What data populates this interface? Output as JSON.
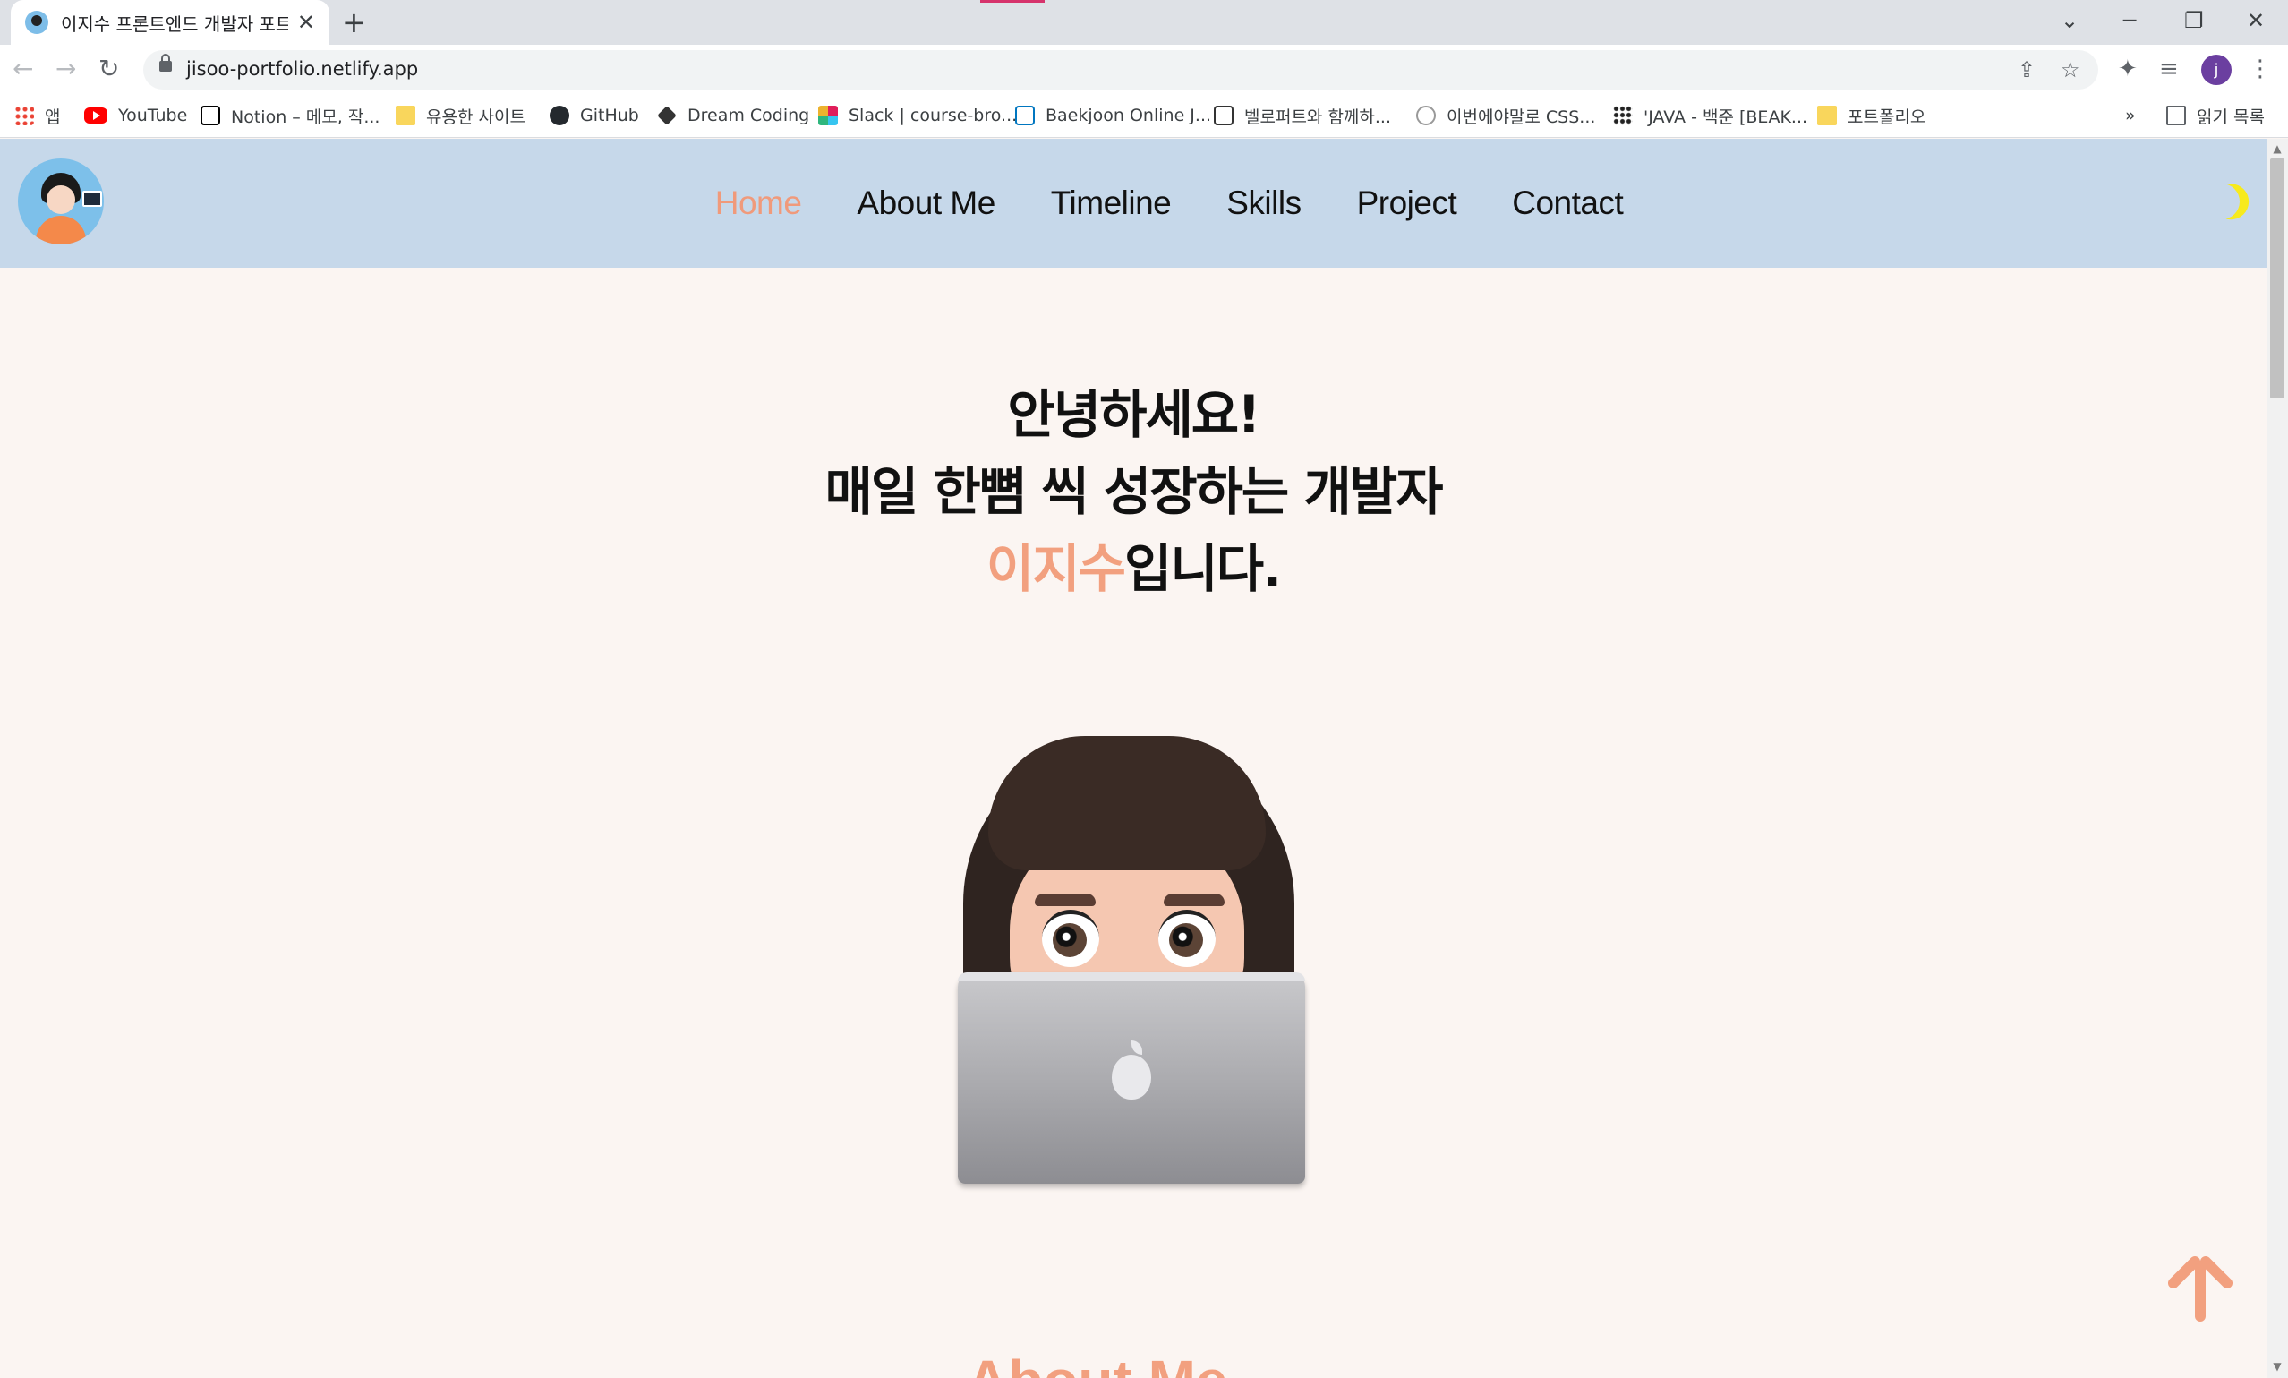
{
  "browser": {
    "tab_title": "이지수 프론트엔드 개발자 포트폴리오",
    "url": "jisoo-portfolio.netlify.app",
    "profile_initial": "j",
    "bookmarks": [
      {
        "label": "앱",
        "icon": "apps-grid-icon"
      },
      {
        "label": "YouTube",
        "icon": "youtube-icon"
      },
      {
        "label": "Notion – 메모, 작...",
        "icon": "notion-icon"
      },
      {
        "label": "유용한 사이트",
        "icon": "folder-icon"
      },
      {
        "label": "GitHub",
        "icon": "github-icon"
      },
      {
        "label": "Dream Coding",
        "icon": "dream-coding-icon"
      },
      {
        "label": "Slack | course-bro...",
        "icon": "slack-icon"
      },
      {
        "label": "Baekjoon Online J...",
        "icon": "baekjoon-icon"
      },
      {
        "label": "벨로퍼트와 함께하...",
        "icon": "book-icon"
      },
      {
        "label": "이번에야말로 CSS...",
        "icon": "css-icon"
      },
      {
        "label": "'JAVA - 백준 [BEAK...",
        "icon": "java-icon"
      },
      {
        "label": "포트폴리오",
        "icon": "folder-icon"
      }
    ],
    "overflow_label": "»",
    "reading_list": "읽기 목록"
  },
  "nav": {
    "items": [
      "Home",
      "About Me",
      "Timeline",
      "Skills",
      "Project",
      "Contact"
    ],
    "active": "Home"
  },
  "hero": {
    "line1": "안녕하세요!",
    "line2": "매일 한뼘 씩 성장하는 개발자",
    "name": "이지수",
    "suffix": "입니다."
  },
  "next_section_peek": "About Me",
  "colors": {
    "accent": "#f2a07f",
    "navbar_bg": "#c6d8ea",
    "page_bg": "#fbf5f2",
    "moon": "#f7ea1c"
  }
}
